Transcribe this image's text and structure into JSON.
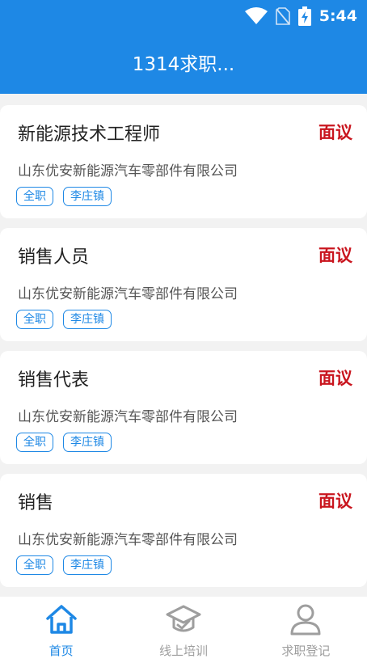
{
  "status_bar": {
    "time": "5:44",
    "icons": [
      "wifi-icon",
      "no-sim-icon",
      "battery-charging-icon"
    ]
  },
  "header": {
    "title": "1314求职..."
  },
  "jobs": [
    {
      "title": "新能源技术工程师",
      "salary": "面议",
      "company": "山东优安新能源汽车零部件有限公司",
      "tags": [
        "全职",
        "李庄镇"
      ]
    },
    {
      "title": "销售人员",
      "salary": "面议",
      "company": "山东优安新能源汽车零部件有限公司",
      "tags": [
        "全职",
        "李庄镇"
      ]
    },
    {
      "title": "销售代表",
      "salary": "面议",
      "company": "山东优安新能源汽车零部件有限公司",
      "tags": [
        "全职",
        "李庄镇"
      ]
    },
    {
      "title": "销售",
      "salary": "面议",
      "company": "山东优安新能源汽车零部件有限公司",
      "tags": [
        "全职",
        "李庄镇"
      ]
    }
  ],
  "bottom_nav": {
    "items": [
      {
        "label": "首页",
        "icon": "home-icon",
        "active": true
      },
      {
        "label": "线上培训",
        "icon": "graduation-cap-icon",
        "active": false
      },
      {
        "label": "求职登记",
        "icon": "person-icon",
        "active": false
      }
    ]
  },
  "colors": {
    "primary": "#1e88e5",
    "salary": "#c9151e",
    "inactive": "#9e9e9e"
  }
}
